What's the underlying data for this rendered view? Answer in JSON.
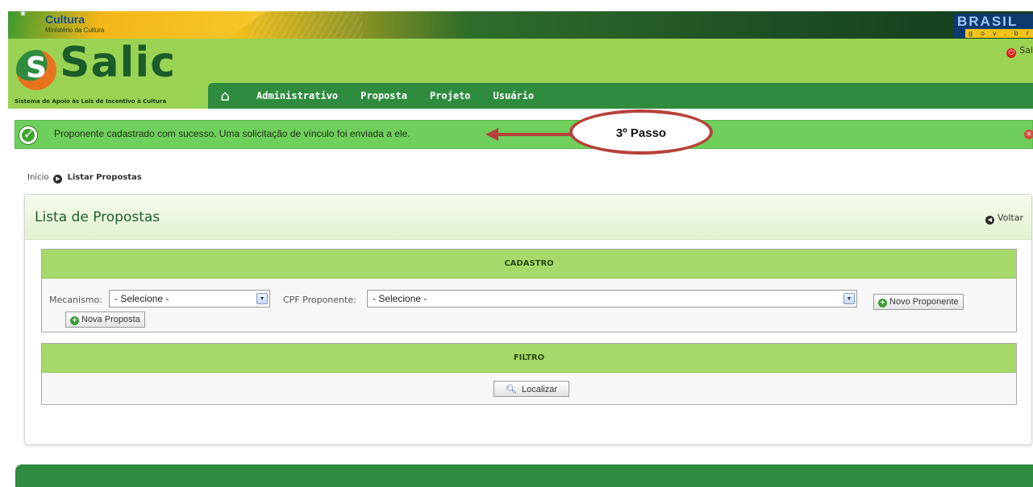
{
  "gov_bar": {
    "ministry_title": "Cultura",
    "ministry_subtitle": "Ministério da Cultura",
    "country_brand": "BRASIL",
    "country_domain": "gov.br"
  },
  "header": {
    "logo_text": "Salic",
    "logo_subtitle": "Sistema de Apoio às Leis de Incentivo à Cultura",
    "exit_label": "Sai"
  },
  "nav": {
    "items": [
      "Administrativo",
      "Proposta",
      "Projeto",
      "Usuário"
    ]
  },
  "alert": {
    "message": "Proponente cadastrado com sucesso. Uma solicitação de vínculo foi enviada a ele."
  },
  "annotation": {
    "step_label": "3º Passo"
  },
  "breadcrumb": {
    "home": "Início",
    "current": "Listar Propostas"
  },
  "panel": {
    "title": "Lista de Propostas",
    "back_label": "Voltar",
    "cadastro": {
      "header": "CADASTRO",
      "mecanismo_label": "Mecanismo:",
      "mecanismo_value": "- Selecione -",
      "cpf_label": "CPF Proponente:",
      "cpf_value": "- Selecione -",
      "novo_proponente_label": "Novo Proponente",
      "nova_proposta_label": "Nova Proposta"
    },
    "filtro": {
      "header": "FILTRO",
      "localizar_label": "Localizar"
    }
  },
  "colors": {
    "header_green": "#9ad253",
    "nav_green": "#2f8c3e",
    "success_green": "#6fcf5c",
    "section_header_green": "#a6d96a",
    "annotation_red": "#b7423a"
  },
  "icons": [
    "star-icon",
    "home-icon",
    "power-icon",
    "checkmark-icon",
    "close-icon",
    "chevron-right-icon",
    "back-icon",
    "dropdown-arrow-icon",
    "plus-icon",
    "magnifier-icon"
  ]
}
